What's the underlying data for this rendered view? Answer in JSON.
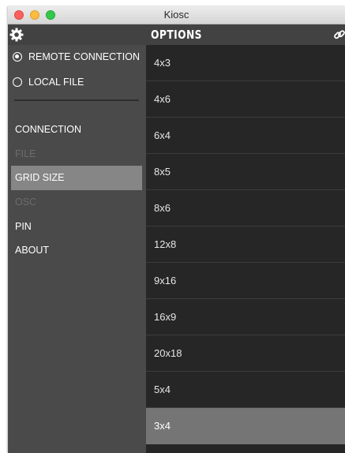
{
  "window": {
    "title": "Kiosc"
  },
  "toolbar": {
    "title": "OPTIONS",
    "left_icon": "gear-icon",
    "right_icon": "link-icon"
  },
  "sidebar": {
    "source_options": [
      {
        "label": "REMOTE CONNECTION",
        "checked": true
      },
      {
        "label": "LOCAL FILE",
        "checked": false
      }
    ],
    "menu": [
      {
        "label": "CONNECTION",
        "state": "enabled"
      },
      {
        "label": "FILE",
        "state": "disabled"
      },
      {
        "label": "GRID SIZE",
        "state": "selected"
      },
      {
        "label": "OSC",
        "state": "disabled"
      },
      {
        "label": "PIN",
        "state": "enabled"
      },
      {
        "label": "ABOUT",
        "state": "enabled"
      }
    ]
  },
  "grid_sizes": {
    "options": [
      "4x3",
      "4x6",
      "6x4",
      "8x5",
      "8x6",
      "12x8",
      "9x16",
      "16x9",
      "20x18",
      "5x4",
      "3x4"
    ],
    "selected": "3x4"
  },
  "colors": {
    "sidebar_bg": "#4a4a4a",
    "content_bg": "#262626",
    "selected_menu_bg": "#868686",
    "selected_row_bg": "#757575",
    "disabled_text": "#6c6c6c"
  }
}
